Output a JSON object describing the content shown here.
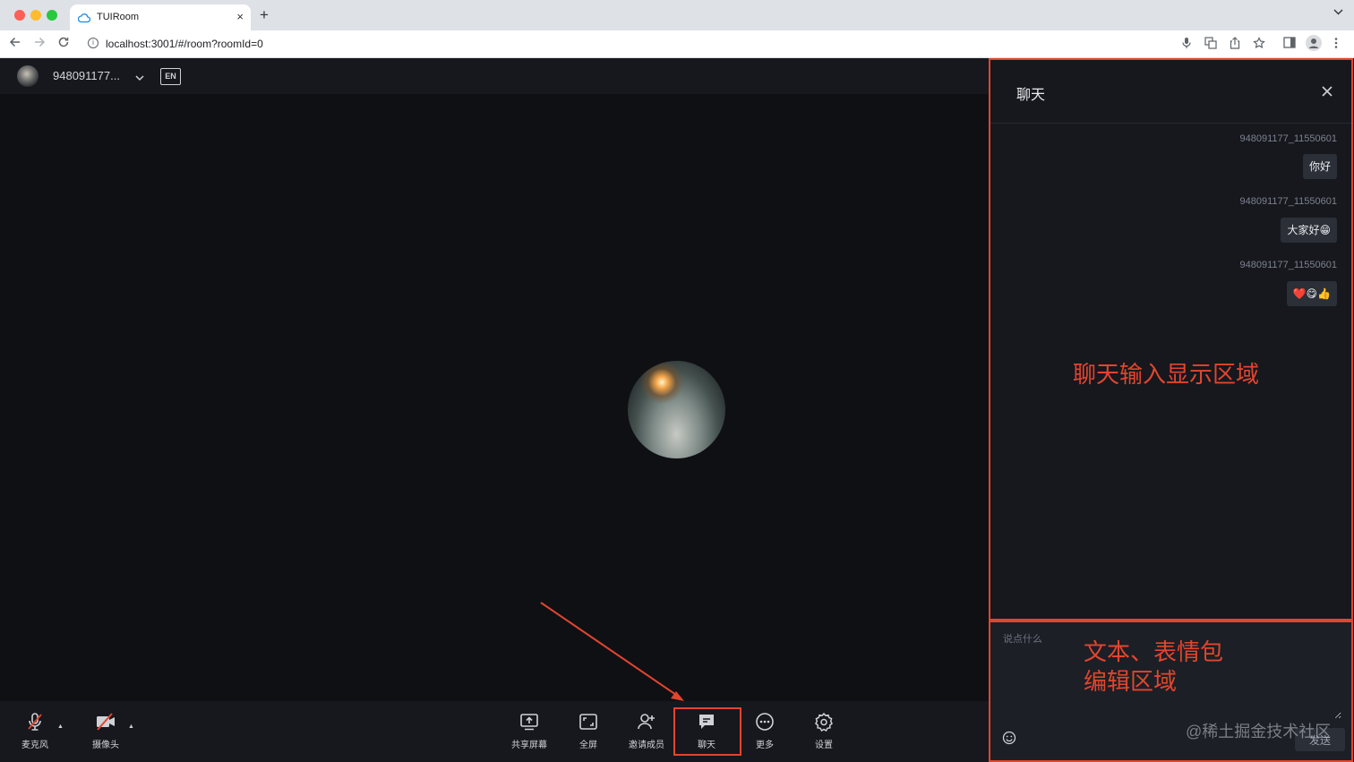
{
  "browser": {
    "tab_title": "TUIRoom",
    "tab_close": "×",
    "new_tab": "+",
    "url": "localhost:3001/#/room?roomId=0"
  },
  "header": {
    "user_name": "948091177..."
  },
  "toolbar": {
    "microphone": "麦克风",
    "camera": "摄像头",
    "share_screen": "共享屏幕",
    "fullscreen": "全屏",
    "invite": "邀请成员",
    "chat": "聊天",
    "more": "更多",
    "settings": "设置"
  },
  "chat": {
    "title": "聊天",
    "messages": [
      {
        "sender": "948091177_11550601",
        "text": "你好"
      },
      {
        "sender": "948091177_11550601",
        "text": "大家好😁"
      },
      {
        "sender": "948091177_11550601",
        "text": "❤️😋👍"
      }
    ],
    "input_placeholder": "说点什么",
    "send_label": "发送"
  },
  "annotations": {
    "display_area": "聊天输入显示区域",
    "edit_area_line1": "文本、表情包",
    "edit_area_line2": "编辑区域",
    "watermark": "@稀土掘金技术社区"
  },
  "colors": {
    "highlight": "#e2452f",
    "panel_bg": "#16181d",
    "stage_bg": "#0f1014"
  }
}
